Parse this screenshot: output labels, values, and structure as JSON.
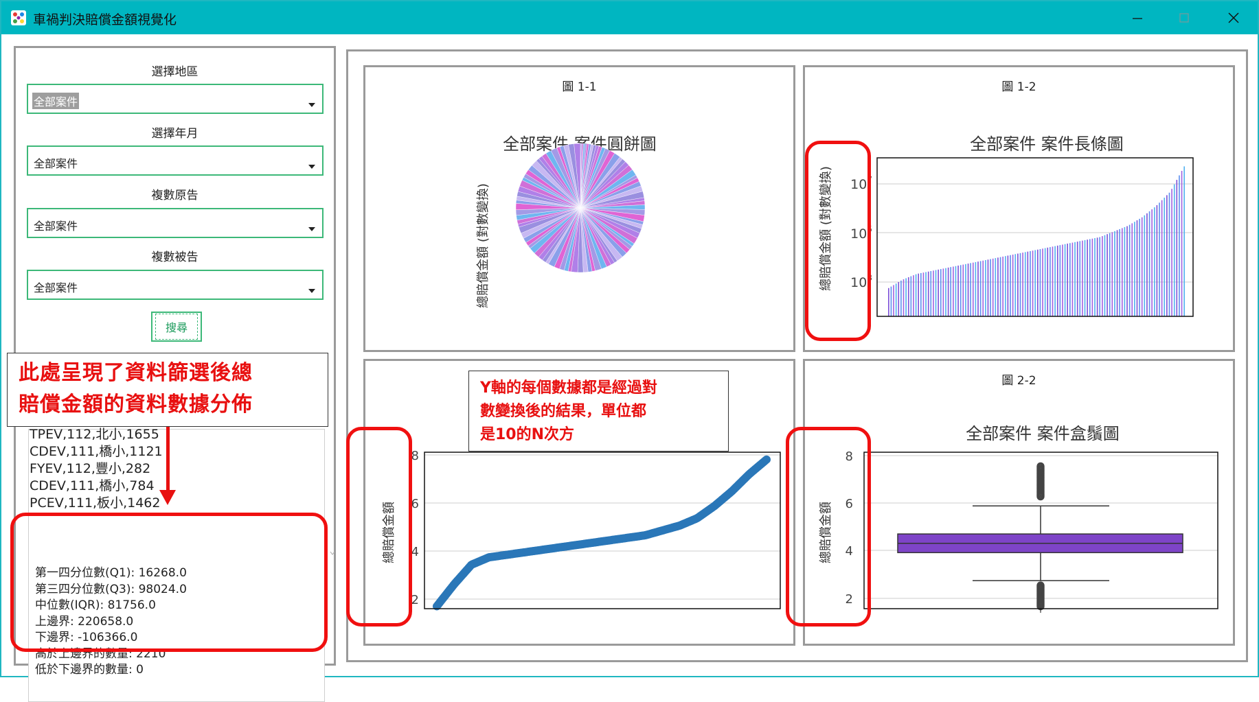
{
  "window": {
    "title": "車禍判決賠償金額視覺化",
    "controls": [
      "minimize",
      "maximize",
      "close"
    ]
  },
  "filters": [
    {
      "label": "選擇地區",
      "value": "全部案件"
    },
    {
      "label": "選擇年月",
      "value": "全部案件"
    },
    {
      "label": "複數原告",
      "value": "全部案件"
    },
    {
      "label": "複數被告",
      "value": "全部案件"
    }
  ],
  "search_button": "搜尋",
  "list_rows": [
    "TPEV,112,北小,1655",
    "CDEV,111,橋小,1121",
    "FYEV,112,豐小,282",
    "CDEV,111,橋小,784",
    "PCEV,111,板小,1462"
  ],
  "stats": [
    "第一四分位數(Q1): 16268.0",
    "第三四分位數(Q3): 98024.0",
    "中位數(IQR): 81756.0",
    "上邊界: 220658.0",
    "下邊界: -106366.0",
    "高於上邊界的數量: 2210",
    "低於下邊界的數量: 0"
  ],
  "annotation_left": [
    "此處呈現了資料篩選後總",
    "賠償金額的資料數據分佈"
  ],
  "annotation_y": [
    "Y軸的每個數據都是經過對",
    "數變換後的結果，單位都",
    "是10的N次方"
  ],
  "charts": {
    "c11": {
      "card_title": "圖 1-1",
      "title": "全部案件 案件圓餅圖",
      "ylabel": "總賠償金額 (對數變換)"
    },
    "c12": {
      "card_title": "圖 1-2",
      "title": "全部案件 案件長條圖",
      "ylabel": "總賠償金額 (對數變換)",
      "yticks": [
        "10",
        "10",
        "10"
      ],
      "yexp": [
        "7",
        "5",
        "3"
      ]
    },
    "c21": {
      "card_title": "",
      "title": "",
      "ylabel": "總賠償金額",
      "yticks": [
        "8",
        "6",
        "4",
        "2"
      ]
    },
    "c22": {
      "card_title": "圖 2-2",
      "title": "全部案件 案件盒鬚圖",
      "ylabel": "總賠償金額",
      "yticks": [
        "8",
        "6",
        "4",
        "2"
      ]
    }
  },
  "chart_data": [
    {
      "type": "pie",
      "title": "全部案件 案件圓餅圖",
      "ylabel": "總賠償金額 (對數變換)",
      "note": "many thin slices in purple/pink/blue shades"
    },
    {
      "type": "bar",
      "title": "全部案件 案件長條圖",
      "ylabel": "總賠償金額 (對數變換)",
      "yscale": "log",
      "ylim": [
        100,
        40000000
      ],
      "values_log10_sorted": [
        3.0,
        3.3,
        3.5,
        3.6,
        3.7,
        3.8,
        3.9,
        4.0,
        4.1,
        4.2,
        4.3,
        4.4,
        4.5,
        4.6,
        4.7,
        4.8,
        5.0,
        5.2,
        5.5,
        5.9,
        6.4,
        7.3
      ]
    },
    {
      "type": "scatter",
      "title": "",
      "ylabel": "總賠償金額",
      "ylim": [
        1.8,
        8.2
      ],
      "y_sorted": [
        1.9,
        2.8,
        3.6,
        3.9,
        4.0,
        4.1,
        4.2,
        4.3,
        4.4,
        4.5,
        4.6,
        4.7,
        4.8,
        5.0,
        5.2,
        5.5,
        6.0,
        6.6,
        7.3,
        7.9
      ]
    },
    {
      "type": "box",
      "title": "全部案件 案件盒鬚圖",
      "ylabel": "總賠償金額",
      "ylim": [
        1.8,
        8.5
      ],
      "whisker_low": 3.0,
      "q1": 4.2,
      "median": 4.6,
      "q3": 5.0,
      "whisker_high": 6.2,
      "outliers_low": [
        1.9,
        2.3,
        2.5,
        2.8
      ],
      "outliers_high": [
        6.6,
        7.0,
        7.4,
        7.8,
        7.9
      ]
    }
  ]
}
